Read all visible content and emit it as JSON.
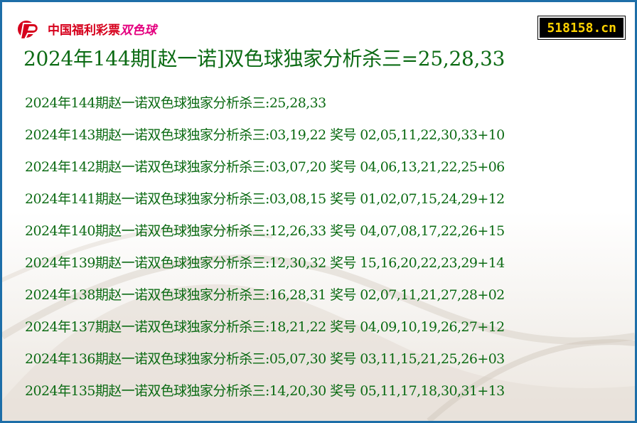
{
  "header": {
    "logo_text": "中国福利彩票",
    "logo_sub": "双色球",
    "site": "518158.cn",
    "title": "2024年144期[赵一诺]双色球独家分析杀三=25,28,33"
  },
  "rows": [
    "2024年144期赵一诺双色球独家分析杀三:25,28,33",
    "2024年143期赵一诺双色球独家分析杀三:03,19,22 奖号 02,05,11,22,30,33+10",
    "2024年142期赵一诺双色球独家分析杀三:03,07,20 奖号 04,06,13,21,22,25+06",
    "2024年141期赵一诺双色球独家分析杀三:03,08,15 奖号 01,02,07,15,24,29+12",
    "2024年140期赵一诺双色球独家分析杀三:12,26,33 奖号 04,07,08,17,22,26+15",
    "2024年139期赵一诺双色球独家分析杀三:12,30,32 奖号 15,16,20,22,23,29+14",
    "2024年138期赵一诺双色球独家分析杀三:16,28,31 奖号 02,07,11,21,27,28+02",
    "2024年137期赵一诺双色球独家分析杀三:18,21,22 奖号 04,09,10,19,26,27+12",
    "2024年136期赵一诺双色球独家分析杀三:05,07,30 奖号 03,11,15,21,25,26+03",
    "2024年135期赵一诺双色球独家分析杀三:14,20,30 奖号 05,11,17,18,30,31+13"
  ],
  "colors": {
    "text_green": "#0c6b14",
    "border_blue": "#1d6ea8",
    "logo_red": "#d6001c",
    "badge_bg": "#000000",
    "badge_text": "#ffd200"
  }
}
